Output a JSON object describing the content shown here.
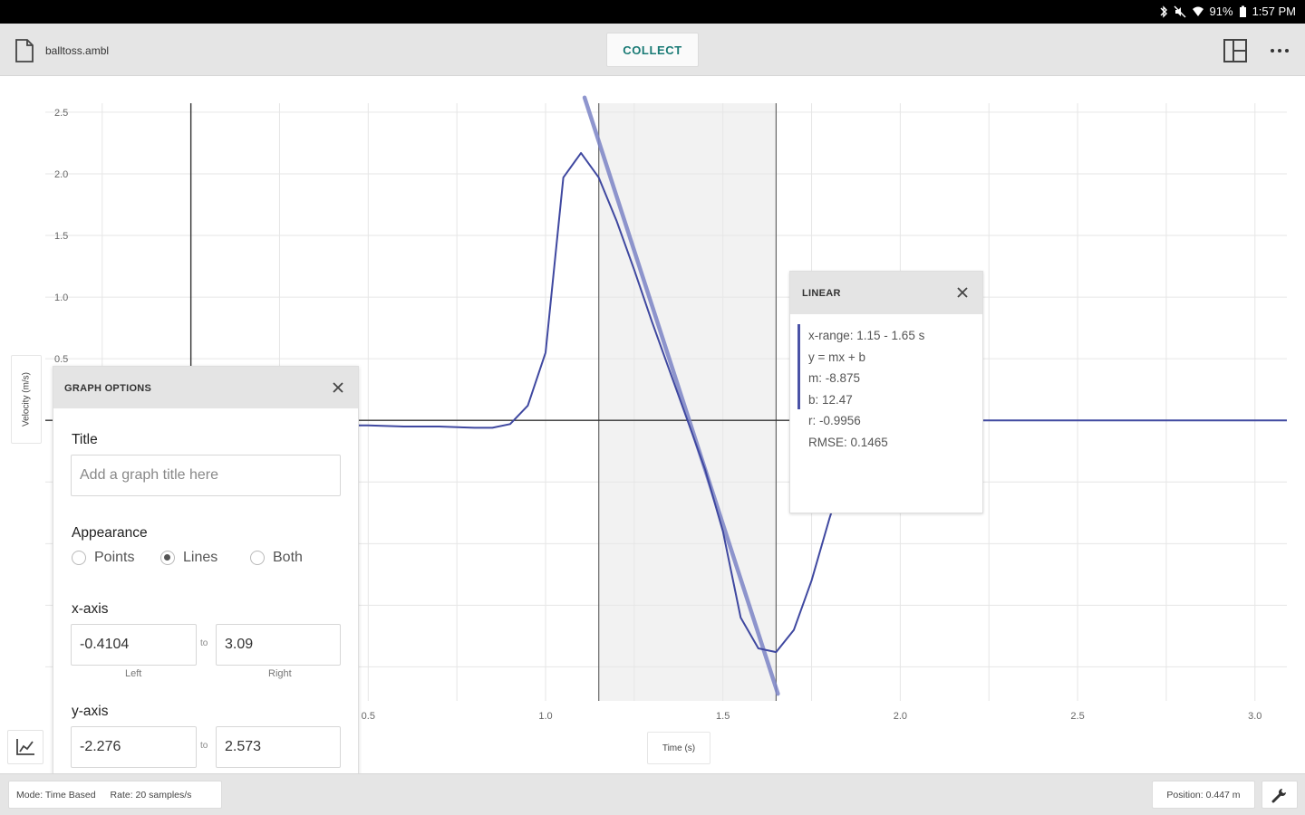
{
  "status_bar": {
    "battery": "91%",
    "time": "1:57 PM"
  },
  "toolbar": {
    "file_name": "balltoss.ambl",
    "collect_label": "COLLECT"
  },
  "chart_data": {
    "type": "line",
    "xlabel": "Time (s)",
    "ylabel": "Velocity (m/s)",
    "xlim": [
      -0.4104,
      3.09
    ],
    "ylim": [
      -2.276,
      2.573
    ],
    "x_ticks": [
      "0.5",
      "1.0",
      "1.5",
      "2.0",
      "2.5",
      "3.0"
    ],
    "y_ticks": [
      "2.5",
      "2.0",
      "1.5",
      "1.0",
      "0.5"
    ],
    "x_tick_values": [
      0.5,
      1.0,
      1.5,
      2.0,
      2.5,
      3.0
    ],
    "y_tick_values": [
      2.5,
      2.0,
      1.5,
      1.0,
      0.5
    ],
    "selection_range": [
      1.15,
      1.65
    ],
    "series": [
      {
        "color": "#3f48a0",
        "x": [
          0.0,
          0.2,
          0.4,
          0.5,
          0.6,
          0.7,
          0.8,
          0.85,
          0.9,
          0.95,
          1.0,
          1.05,
          1.1,
          1.15,
          1.2,
          1.25,
          1.3,
          1.35,
          1.4,
          1.45,
          1.5,
          1.55,
          1.6,
          1.65,
          1.7,
          1.75,
          1.8,
          1.85,
          1.9,
          2.0,
          2.2,
          2.5,
          2.8,
          3.09
        ],
        "y": [
          -0.02,
          -0.03,
          -0.04,
          -0.04,
          -0.05,
          -0.05,
          -0.06,
          -0.06,
          -0.03,
          0.12,
          0.55,
          1.97,
          2.17,
          1.97,
          1.62,
          1.22,
          0.8,
          0.4,
          0.0,
          -0.4,
          -0.9,
          -1.6,
          -1.85,
          -1.88,
          -1.7,
          -1.3,
          -0.8,
          -0.35,
          -0.05,
          0.01,
          0.0,
          0.0,
          0.0,
          0.0
        ]
      }
    ],
    "fit_line": {
      "color": "#7c84c6",
      "m": -8.875,
      "b": 12.47,
      "x_from": 1.11,
      "x_to": 1.655
    }
  },
  "fit_panel": {
    "title": "LINEAR",
    "x_range": "x-range: 1.15 - 1.65 s",
    "equation": "y = mx + b",
    "m": "m: -8.875",
    "b": "b: 12.47",
    "r": "r: -0.9956",
    "rmse": "RMSE: 0.1465"
  },
  "graph_options": {
    "title": "GRAPH OPTIONS",
    "title_label": "Title",
    "title_placeholder": "Add a graph title here",
    "appearance_label": "Appearance",
    "appearance_options": [
      "Points",
      "Lines",
      "Both"
    ],
    "appearance_selected": "Lines",
    "xaxis_label": "x-axis",
    "xaxis_left": "-0.4104",
    "xaxis_right": "3.09",
    "to_text": "to",
    "left_caption": "Left",
    "right_caption": "Right",
    "yaxis_label": "y-axis",
    "yaxis_bottom": "-2.276",
    "yaxis_top": "2.573"
  },
  "bottom_bar": {
    "mode": "Mode: Time Based",
    "rate": "Rate: 20 samples/s",
    "position": "Position: 0.447 m"
  },
  "colors": {
    "accent": "#197a75",
    "series": "#3f48a0"
  }
}
